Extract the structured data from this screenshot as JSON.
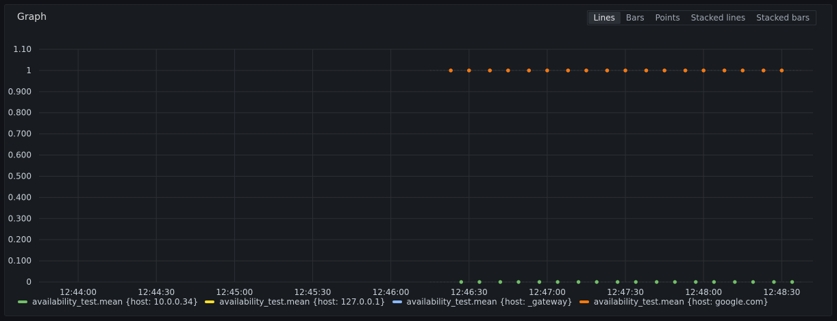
{
  "panel": {
    "title": "Graph",
    "view_modes": [
      "Lines",
      "Bars",
      "Points",
      "Stacked lines",
      "Stacked bars"
    ],
    "active_view_mode": "Lines"
  },
  "colors": {
    "green": "#73bf69",
    "yellow": "#fade2a",
    "blue": "#8ab8ff",
    "orange": "#ff780a",
    "grid": "#2c2f35",
    "axis_text": "#c7d0d9"
  },
  "chart_data": {
    "type": "scatter",
    "title": "",
    "xlabel": "",
    "ylabel": "",
    "x_ticks": [
      "12:44:00",
      "12:44:30",
      "12:45:00",
      "12:45:30",
      "12:46:00",
      "12:46:30",
      "12:47:00",
      "12:47:30",
      "12:48:00",
      "12:48:30"
    ],
    "y_ticks": [
      "0",
      "0.100",
      "0.200",
      "0.300",
      "0.400",
      "0.500",
      "0.600",
      "0.700",
      "0.800",
      "0.900",
      "1",
      "1.10"
    ],
    "xlim": [
      "12:43:45",
      "12:48:42"
    ],
    "ylim": [
      0,
      1.1
    ],
    "grid": true,
    "legend_position": "bottom",
    "series": [
      {
        "name": "availability_test.mean {host: 10.0.0.34}",
        "color": "#73bf69",
        "x": [
          "12:46:27",
          "12:46:34",
          "12:46:42",
          "12:46:49",
          "12:46:57",
          "12:47:04",
          "12:47:12",
          "12:47:19",
          "12:47:27",
          "12:47:34",
          "12:47:42",
          "12:47:49",
          "12:47:57",
          "12:48:04",
          "12:48:12",
          "12:48:19",
          "12:48:27",
          "12:48:34"
        ],
        "y": [
          0,
          0,
          0,
          0,
          0,
          0,
          0,
          0,
          0,
          0,
          0,
          0,
          0,
          0,
          0,
          0,
          0,
          0
        ]
      },
      {
        "name": "availability_test.mean {host: 127.0.0.1}",
        "color": "#fade2a",
        "x": [],
        "y": []
      },
      {
        "name": "availability_test.mean {host: _gateway}",
        "color": "#8ab8ff",
        "x": [
          "12:46:23",
          "12:46:30",
          "12:46:38",
          "12:46:45",
          "12:46:53",
          "12:47:00",
          "12:47:08",
          "12:47:15",
          "12:47:23",
          "12:47:30",
          "12:47:38",
          "12:47:45",
          "12:47:53",
          "12:48:00",
          "12:48:08",
          "12:48:15",
          "12:48:23",
          "12:48:30"
        ],
        "y": [
          1,
          1,
          1,
          1,
          1,
          1,
          1,
          1,
          1,
          1,
          1,
          1,
          1,
          1,
          1,
          1,
          1,
          1
        ]
      },
      {
        "name": "availability_test.mean {host: google.com}",
        "color": "#ff780a",
        "x": [
          "12:46:23",
          "12:46:30",
          "12:46:38",
          "12:46:45",
          "12:46:53",
          "12:47:00",
          "12:47:08",
          "12:47:15",
          "12:47:23",
          "12:47:30",
          "12:47:38",
          "12:47:45",
          "12:47:53",
          "12:48:00",
          "12:48:08",
          "12:48:15",
          "12:48:23",
          "12:48:30"
        ],
        "y": [
          1,
          1,
          1,
          1,
          1,
          1,
          1,
          1,
          1,
          1,
          1,
          1,
          1,
          1,
          1,
          1,
          1,
          1
        ]
      }
    ]
  }
}
